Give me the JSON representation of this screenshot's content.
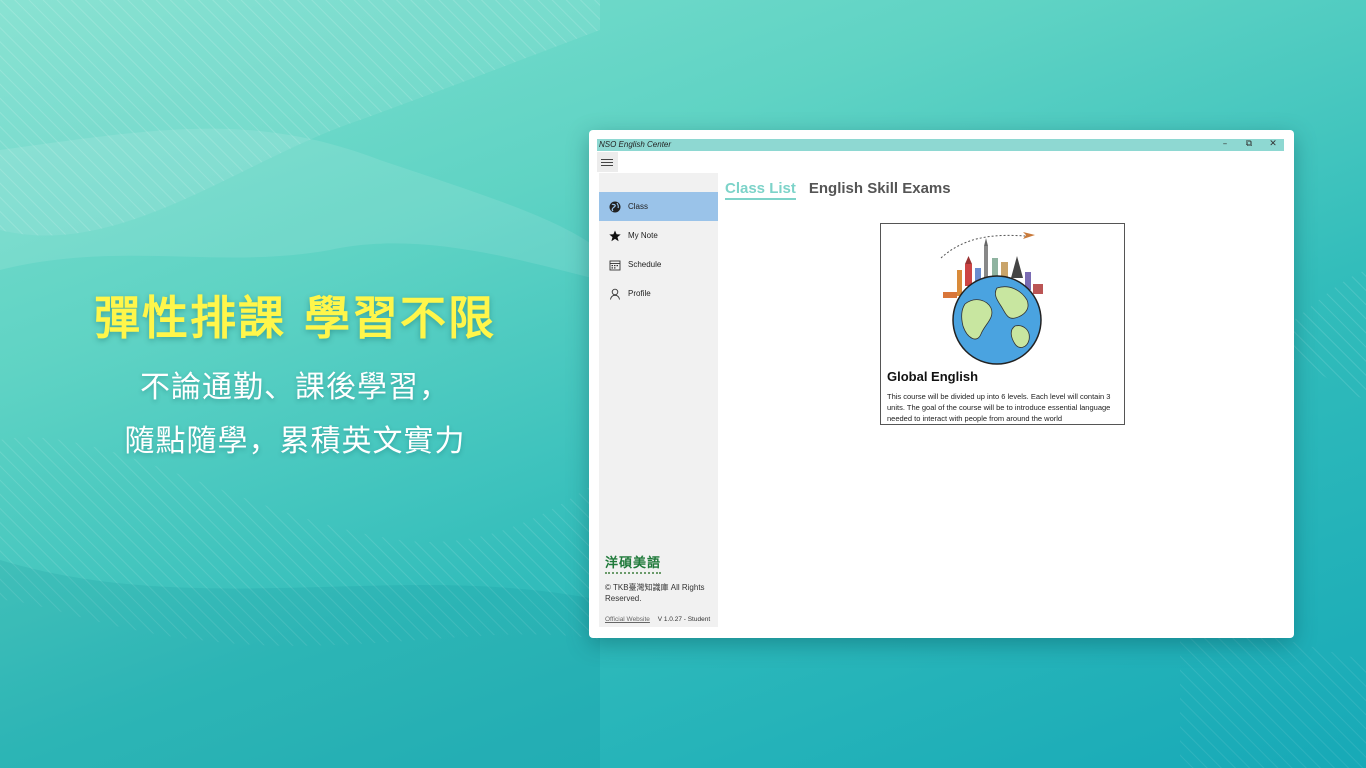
{
  "promo": {
    "title": "彈性排課 學習不限",
    "line1": "不論通勤、課後學習，",
    "line2": "隨點隨學，累積英文實力"
  },
  "window": {
    "title": "NSO English Center",
    "controls": {
      "minimize": "–",
      "restore": "⧉",
      "close": "✕"
    }
  },
  "sidebar": {
    "items": [
      {
        "label": "Class",
        "icon": "globe-icon",
        "active": true
      },
      {
        "label": "My Note",
        "icon": "star-icon",
        "active": false
      },
      {
        "label": "Schedule",
        "icon": "calendar-icon",
        "active": false
      },
      {
        "label": "Profile",
        "icon": "person-icon",
        "active": false
      }
    ],
    "brand": "洋碩美語",
    "copyright": "© TKB臺灣知識庫 All Rights Reserved.",
    "website_link": "Official Website",
    "version": "V 1.0.27 - Student"
  },
  "tabs": [
    {
      "label": "Class List",
      "active": true
    },
    {
      "label": "English Skill Exams",
      "active": false
    }
  ],
  "courses": [
    {
      "title": "Global English",
      "image": "globe-landmarks-illustration",
      "description": "This course will be divided up into 6 levels. Each level will contain 3 units. The goal of the course will be to introduce essential language needed to interact with people from around the world"
    }
  ],
  "colors": {
    "accent": "#7dd3c9",
    "titlebar": "#8ed8d2",
    "active_nav": "#9ac3e9",
    "promo_title": "#fff64a"
  }
}
